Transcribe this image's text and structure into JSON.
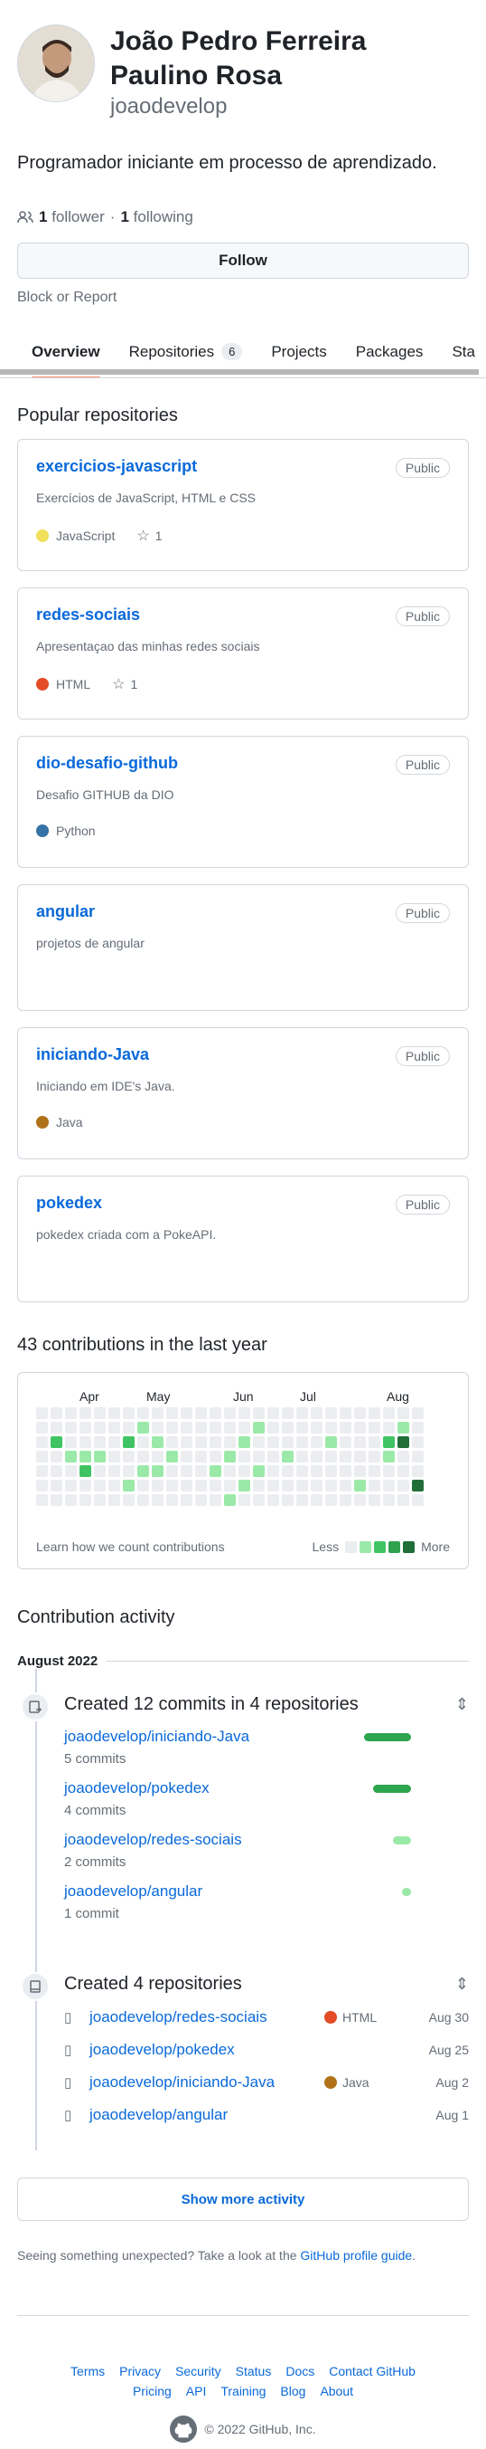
{
  "profile": {
    "full_name": "João Pedro Ferreira Paulino Rosa",
    "username": "joaodevelop",
    "bio": "Programador iniciante em processo de aprendizado.",
    "followers_count": "1",
    "followers_label": "follower",
    "following_count": "1",
    "following_label": "following",
    "follow_button": "Follow",
    "block_report": "Block or Report"
  },
  "tabs": [
    {
      "label": "Overview"
    },
    {
      "label": "Repositories",
      "count": "6"
    },
    {
      "label": "Projects"
    },
    {
      "label": "Packages"
    },
    {
      "label": "Sta"
    }
  ],
  "popular": {
    "title": "Popular repositories",
    "repos": [
      {
        "name": "exercicios-javascript",
        "visibility": "Public",
        "description": "Exercícios de JavaScript, HTML e CSS",
        "language": "JavaScript",
        "lang_color": "#f1e05a",
        "stars": "1"
      },
      {
        "name": "redes-sociais",
        "visibility": "Public",
        "description": "Apresentaçao das minhas redes sociais",
        "language": "HTML",
        "lang_color": "#e34c26",
        "stars": "1"
      },
      {
        "name": "dio-desafio-github",
        "visibility": "Public",
        "description": "Desafio GITHUB da DIO",
        "language": "Python",
        "lang_color": "#3572A5"
      },
      {
        "name": "angular",
        "visibility": "Public",
        "description": "projetos de angular"
      },
      {
        "name": "iniciando-Java",
        "visibility": "Public",
        "description": "Iniciando em IDE's Java.",
        "language": "Java",
        "lang_color": "#b07219"
      },
      {
        "name": "pokedex",
        "visibility": "Public",
        "description": "pokedex criada com a PokeAPI."
      }
    ]
  },
  "contributions": {
    "title": "43 contributions in the last year",
    "months": [
      "Apr",
      "May",
      "Jun",
      "Jul",
      "Aug"
    ],
    "learn_link": "Learn how we count contributions",
    "less": "Less",
    "more": "More"
  },
  "activity": {
    "title": "Contribution activity",
    "month": "August 2022",
    "commits_event": "Created 12 commits in 4 repositories",
    "commits": [
      {
        "repo": "joaodevelop/iniciando-Java",
        "count": "5 commits"
      },
      {
        "repo": "joaodevelop/pokedex",
        "count": "4 commits"
      },
      {
        "repo": "joaodevelop/redes-sociais",
        "count": "2 commits"
      },
      {
        "repo": "joaodevelop/angular",
        "count": "1 commit"
      }
    ],
    "repos_event": "Created 4 repositories",
    "created": [
      {
        "repo": "joaodevelop/redes-sociais",
        "language": "HTML",
        "lang_color": "#e34c26",
        "date": "Aug 30"
      },
      {
        "repo": "joaodevelop/pokedex",
        "language": "",
        "date": "Aug 25"
      },
      {
        "repo": "joaodevelop/iniciando-Java",
        "language": "Java",
        "lang_color": "#b07219",
        "date": "Aug 2"
      },
      {
        "repo": "joaodevelop/angular",
        "language": "",
        "date": "Aug 1"
      }
    ],
    "show_more": "Show more activity"
  },
  "unexpected": {
    "text": "Seeing something unexpected? Take a look at the",
    "link": "GitHub profile guide",
    "end": "."
  },
  "footer": {
    "links_row1": [
      "Terms",
      "Privacy",
      "Security",
      "Status",
      "Docs",
      "Contact GitHub"
    ],
    "links_row2": [
      "Pricing",
      "API",
      "Training",
      "Blog",
      "About"
    ],
    "copyright": "© 2022 GitHub, Inc."
  },
  "colors": {
    "accent": "#0969da",
    "tab_underline": "#fd8c73",
    "commit_bar": "#2da44e"
  }
}
